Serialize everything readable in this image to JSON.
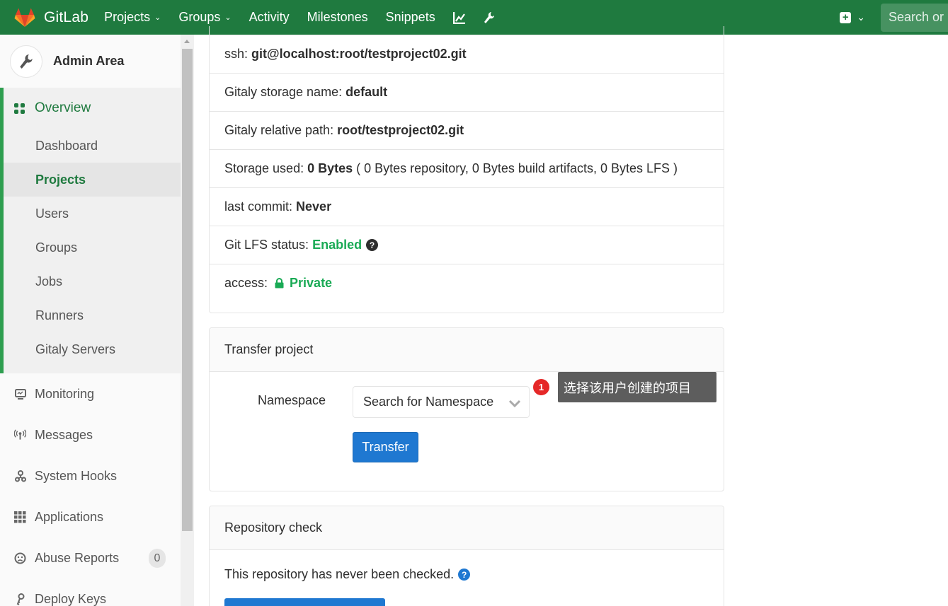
{
  "nav": {
    "brand": "GitLab",
    "items": [
      {
        "label": "Projects",
        "dropdown": true
      },
      {
        "label": "Groups",
        "dropdown": true
      },
      {
        "label": "Activity",
        "dropdown": false
      },
      {
        "label": "Milestones",
        "dropdown": false
      },
      {
        "label": "Snippets",
        "dropdown": false
      }
    ],
    "icons": [
      "chart-icon",
      "wrench-icon"
    ],
    "search_placeholder": "Search or jump to…",
    "search_visible": "Search or"
  },
  "sidebar": {
    "title": "Admin Area",
    "overview_label": "Overview",
    "overview_items": [
      {
        "label": "Dashboard",
        "active": false
      },
      {
        "label": "Projects",
        "active": true
      },
      {
        "label": "Users",
        "active": false
      },
      {
        "label": "Groups",
        "active": false
      },
      {
        "label": "Jobs",
        "active": false
      },
      {
        "label": "Runners",
        "active": false
      },
      {
        "label": "Gitaly Servers",
        "active": false
      }
    ],
    "items": [
      {
        "label": "Monitoring",
        "icon": "monitor-icon"
      },
      {
        "label": "Messages",
        "icon": "broadcast-icon"
      },
      {
        "label": "System Hooks",
        "icon": "hook-icon"
      },
      {
        "label": "Applications",
        "icon": "apps-grid-icon"
      },
      {
        "label": "Abuse Reports",
        "icon": "frown-icon",
        "count": "0"
      },
      {
        "label": "Deploy Keys",
        "icon": "key-icon"
      }
    ]
  },
  "info": {
    "ssh_label": "ssh:",
    "ssh_value": "git@localhost:root/testproject02.git",
    "storage_name_label": "Gitaly storage name:",
    "storage_name_value": "default",
    "relative_path_label": "Gitaly relative path:",
    "relative_path_value": "root/testproject02.git",
    "storage_used_label": "Storage used:",
    "storage_used_value": "0 Bytes",
    "storage_used_detail": "( 0 Bytes repository, 0 Bytes build artifacts, 0 Bytes LFS )",
    "last_commit_label": "last commit:",
    "last_commit_value": "Never",
    "lfs_label": "Git LFS status:",
    "lfs_value": "Enabled",
    "access_label": "access:",
    "access_value": "Private"
  },
  "transfer": {
    "title": "Transfer project",
    "namespace_label": "Namespace",
    "namespace_placeholder": "Search for Namespace",
    "button_label": "Transfer",
    "tooltip_number": "1",
    "tooltip_text": "选择该用户创建的项目"
  },
  "repo_check": {
    "title": "Repository check",
    "message": "This repository has never been checked."
  },
  "colors": {
    "navbar": "#1f7a3f",
    "accent_green": "#1aaa55",
    "primary_blue": "#1f78d1",
    "badge_red": "#e52828"
  }
}
